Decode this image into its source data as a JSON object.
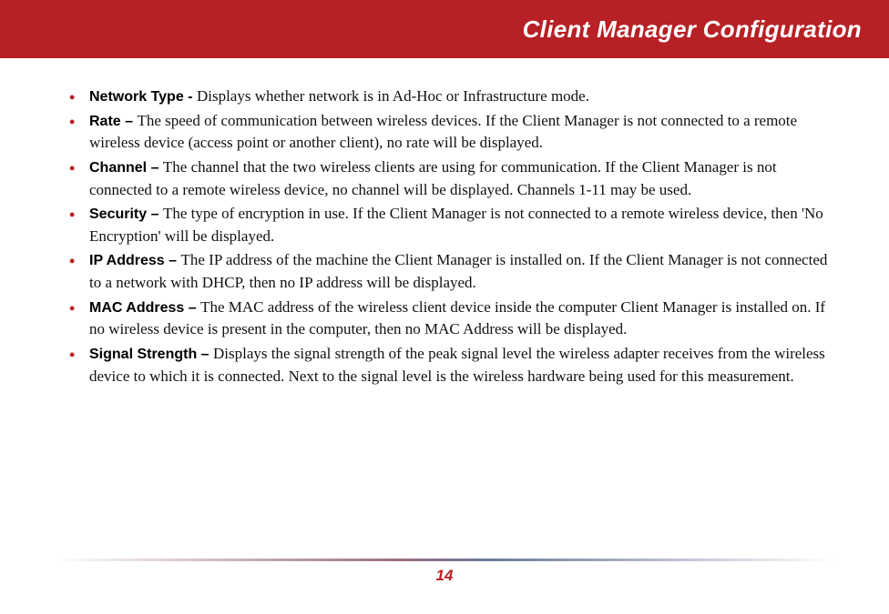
{
  "header": {
    "title": "Client Manager Configuration"
  },
  "items": [
    {
      "term": "Network Type - ",
      "desc": "Displays whether network is in Ad-Hoc or Infrastructure mode."
    },
    {
      "term": "Rate – ",
      "desc": "The speed of communication between wireless devices.  If the Client Manager is not connected to a remote wireless device (access point or another client), no rate will be displayed."
    },
    {
      "term": "Channel – ",
      "desc": "The channel that the two wireless clients are using for communication.  If the Client Manager is not connected to a remote wireless device, no channel will be displayed.  Channels 1-11 may be used."
    },
    {
      "term": "Security – ",
      "desc": "The type of encryption in use.  If the Client Manager is not connected to a remote wireless device, then 'No Encryption' will be displayed."
    },
    {
      "term": "IP Address – ",
      "desc": "The IP address of the machine the Client Manager is installed on. If the Client Manager is not connected to a network with DHCP, then no IP address will be displayed."
    },
    {
      "term": "MAC Address – ",
      "desc": "The MAC address of the wireless client device inside the computer Client Manager is installed on. If no wireless device is present in the computer, then no MAC Address will be displayed."
    },
    {
      "term": "Signal Strength – ",
      "desc": "Displays the signal strength of the peak signal level the wireless adapter receives from the wireless device to which it is connected.  Next to the signal level is the wireless hardware being used for this measurement."
    }
  ],
  "footer": {
    "page": "14"
  }
}
